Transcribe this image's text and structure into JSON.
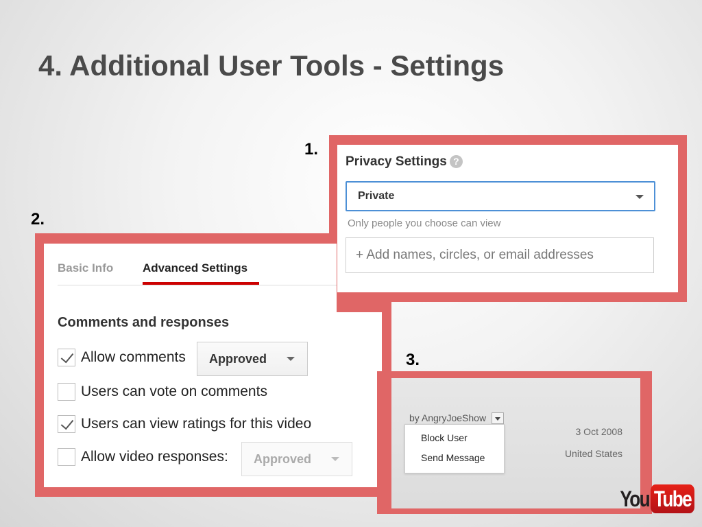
{
  "slide": {
    "title": "4. Additional User Tools - Settings"
  },
  "steps": {
    "one": "1.",
    "two": "2.",
    "three": "3."
  },
  "frame_color": "#e06666",
  "privacy": {
    "heading": "Privacy Settings",
    "help_icon": "question-circle-icon",
    "select_value": "Private",
    "help_text": "Only people you choose can view",
    "share_placeholder": "+ Add names, circles, or email addresses"
  },
  "advanced": {
    "tabs": [
      {
        "label": "Basic Info",
        "active": false
      },
      {
        "label": "Advanced Settings",
        "active": true
      }
    ],
    "section_heading": "Comments and responses",
    "options": [
      {
        "label": "Allow comments",
        "checked": true,
        "select": "Approved",
        "select_enabled": true
      },
      {
        "label": "Users can vote on comments",
        "checked": false
      },
      {
        "label": "Users can view ratings for this video",
        "checked": true
      },
      {
        "label": "Allow video responses:",
        "checked": false,
        "select": "Approved",
        "select_enabled": false
      }
    ]
  },
  "user_menu": {
    "author": "by AngryJoeShow",
    "items": [
      "Block User",
      "Send Message"
    ],
    "date": "3 Oct 2008",
    "location": "United States"
  },
  "logo": {
    "you": "You",
    "tube": "Tube",
    "brand_color": "#e62117"
  }
}
